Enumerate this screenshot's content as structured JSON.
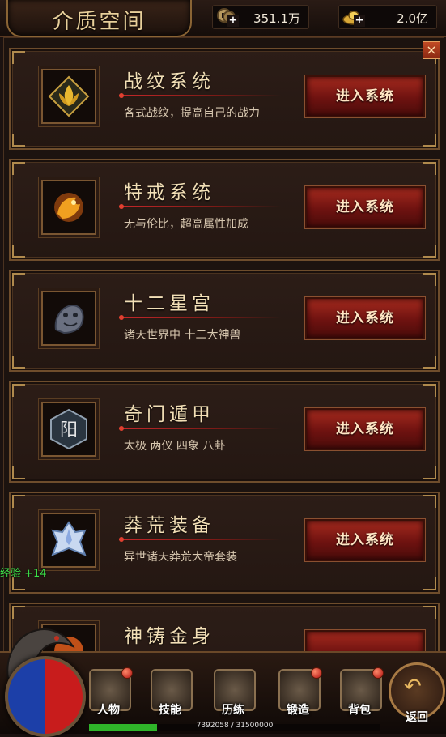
{
  "header": {
    "title": "介质空间",
    "currency": [
      {
        "icon": "coin-icon",
        "value": "351.1万"
      },
      {
        "icon": "gold-ingot-icon",
        "value": "2.0亿"
      }
    ]
  },
  "panel": {
    "close_label": "×",
    "systems": [
      {
        "title": "战纹系统",
        "desc": "各式战纹，提高自己的战力",
        "button": "进入系统",
        "icon": "lotus-emblem-icon"
      },
      {
        "title": "特戒系统",
        "desc": "无与伦比，超高属性加成",
        "button": "进入系统",
        "icon": "fire-dragon-icon"
      },
      {
        "title": "十二星宫",
        "desc": "诸天世界中 十二大神兽",
        "button": "进入系统",
        "icon": "stone-beast-icon"
      },
      {
        "title": "奇门遁甲",
        "desc": "太极 两仪 四象 八卦",
        "button": "进入系统",
        "icon": "yang-seal-icon"
      },
      {
        "title": "莽荒装备",
        "desc": "异世诸天莽荒大帝套装",
        "button": "进入系统",
        "icon": "ice-armor-icon"
      },
      {
        "title": "神铸金身",
        "desc": "",
        "button": "",
        "icon": "golden-body-icon"
      }
    ]
  },
  "float_text": "经验 +14",
  "bottom_nav": {
    "items": [
      {
        "label": "人物",
        "icon": "character-icon"
      },
      {
        "label": "技能",
        "icon": "skill-book-icon"
      },
      {
        "label": "历练",
        "icon": "training-icon"
      },
      {
        "label": "锻造",
        "icon": "anvil-icon"
      },
      {
        "label": "背包",
        "icon": "backpack-icon"
      }
    ],
    "return_label": "返回"
  },
  "exp_bar": {
    "text": "7392058 / 31500000",
    "current": 7392058,
    "max": 31500000
  },
  "colors": {
    "accent_red": "#a52a1e",
    "gold_text": "#f2dfb6",
    "exp_green": "#2fb52a"
  }
}
